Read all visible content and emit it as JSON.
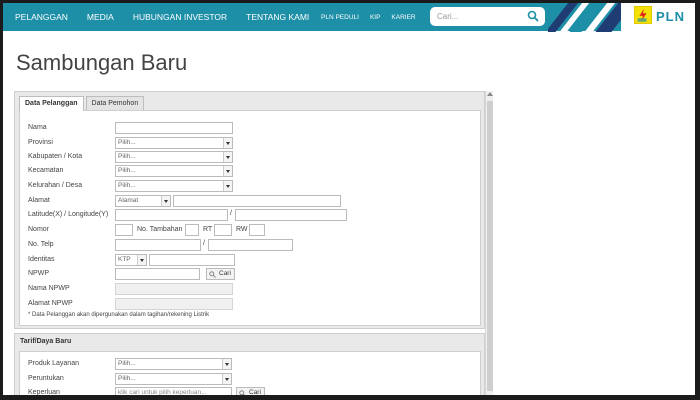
{
  "nav": {
    "items": [
      "PELANGGAN",
      "MEDIA",
      "HUBUNGAN INVESTOR",
      "TENTANG KAMI"
    ],
    "small_items": [
      "PLN PEDULI",
      "KIP",
      "KARIER"
    ]
  },
  "search": {
    "placeholder": "Cari..."
  },
  "logo": {
    "text": "PLN"
  },
  "page": {
    "title": "Sambungan Baru"
  },
  "tabs": [
    {
      "label": "Data Pelanggan",
      "active": true
    },
    {
      "label": "Data Pemohon",
      "active": false
    }
  ],
  "form": {
    "nama_label": "Nama",
    "provinsi_label": "Provinsi",
    "kabupaten_label": "Kabupaten / Kota",
    "kecamatan_label": "Kecamatan",
    "kelurahan_label": "Kelurahan / Desa",
    "alamat_label": "Alamat",
    "latlong_label": "Latitude(X) / Longitude(Y)",
    "nomor_label": "Nomor",
    "no_tambahan_label": "No. Tambahan",
    "rt_label": "RT",
    "rw_label": "RW",
    "notelp_label": "No. Telp",
    "identitas_label": "Identitas",
    "npwp_label": "NPWP",
    "nama_npwp_label": "Nama NPWP",
    "alamat_npwp_label": "Alamat NPWP",
    "select_placeholder": "Pilih...",
    "alamat_select": "Alamat",
    "identitas_select": "KTP",
    "slash": "/",
    "cari_button": "Cari",
    "note": "* Data Pelanggan akan dipergunakan dalam tagihan/rekening Listrik"
  },
  "tarif": {
    "header": "Tarif/Daya Baru",
    "produk_label": "Produk Layanan",
    "peruntukan_label": "Peruntukan",
    "keperluan_label": "Keperluan",
    "keperluan_placeholder": "klik cari untuk pilih keperluan...",
    "select_placeholder": "Pilih...",
    "cari_button": "Cari"
  },
  "colors": {
    "topbar": "#1d8fa7",
    "stripe_dark": "#1f3c73",
    "stripe_light": "#1d8fa7",
    "logo_yellow": "#f5e10a",
    "logo_text": "#1d8fa7"
  }
}
